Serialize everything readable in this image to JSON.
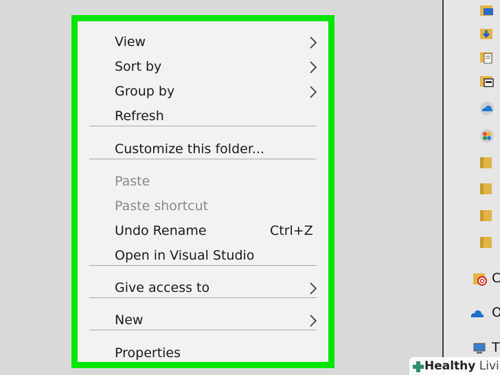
{
  "context_menu": {
    "items": [
      {
        "label": "View",
        "has_submenu": true
      },
      {
        "label": "Sort by",
        "has_submenu": true
      },
      {
        "label": "Group by",
        "has_submenu": true
      },
      {
        "label": "Refresh"
      },
      {
        "label": "Customize this folder..."
      },
      {
        "label": "Paste",
        "disabled": true
      },
      {
        "label": "Paste shortcut",
        "disabled": true
      },
      {
        "label": "Undo Rename",
        "shortcut": "Ctrl+Z"
      },
      {
        "label": "Open in Visual Studio"
      },
      {
        "label": "Give access to",
        "has_submenu": true
      },
      {
        "label": "New",
        "has_submenu": true
      },
      {
        "label": "Properties"
      }
    ],
    "highlight_color": "#00e600"
  },
  "nav_pane": {
    "items": [
      {
        "icon": "desktop-folder-icon"
      },
      {
        "icon": "downloads-folder-icon"
      },
      {
        "icon": "documents-folder-icon"
      },
      {
        "icon": "pictures-folder-icon"
      },
      {
        "icon": "onedrive-cloud-icon"
      },
      {
        "icon": "photos-app-icon"
      },
      {
        "icon": "folder-icon"
      },
      {
        "icon": "folder-icon"
      },
      {
        "icon": "folder-icon"
      },
      {
        "icon": "folder-icon"
      },
      {
        "icon": "creative-cloud-folder-icon",
        "label": "C"
      },
      {
        "icon": "onedrive-icon",
        "label": "O"
      },
      {
        "icon": "this-pc-icon",
        "label": "T"
      }
    ]
  },
  "watermark": {
    "brand_bold": "Healthy",
    "brand_light": " Living"
  }
}
